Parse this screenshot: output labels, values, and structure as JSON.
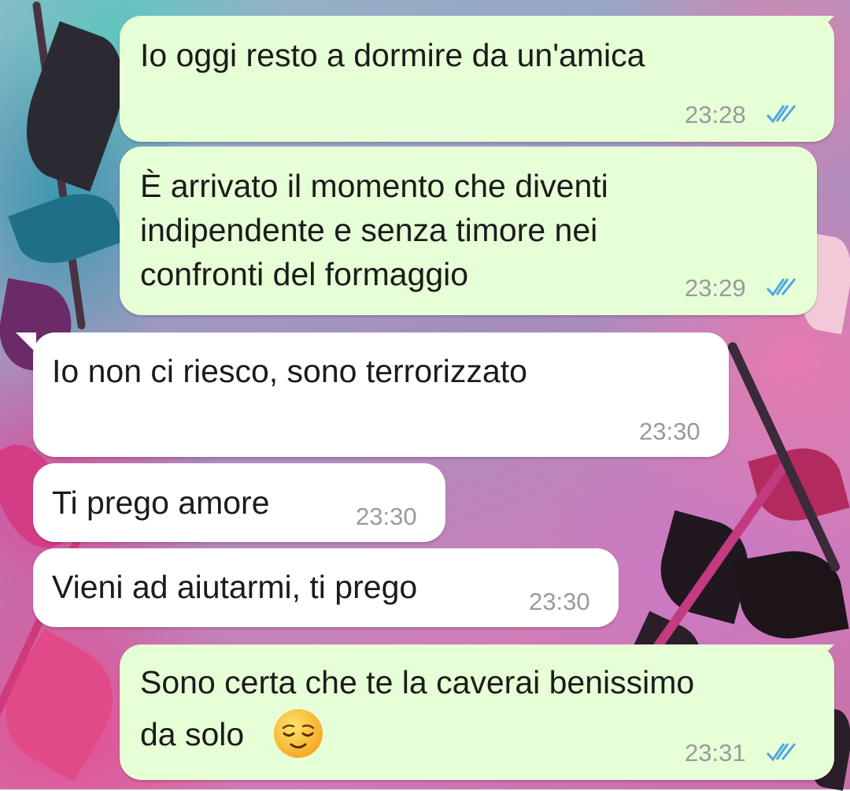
{
  "messages": [
    {
      "direction": "outgoing",
      "text": "Io oggi resto a dormire da un'amica",
      "time": "23:28",
      "status_icon": "double-check-read-icon"
    },
    {
      "direction": "outgoing",
      "lines": [
        "È arrivato il momento che diventi",
        "indipendente e senza timore nei",
        "confronti del formaggio"
      ],
      "time": "23:29",
      "status_icon": "double-check-read-icon"
    },
    {
      "direction": "incoming",
      "text": "Io non ci riesco, sono terrorizzato",
      "time": "23:30"
    },
    {
      "direction": "incoming",
      "text": "Ti prego amore",
      "time": "23:30"
    },
    {
      "direction": "incoming",
      "text": "Vieni ad aiutarmi, ti prego",
      "time": "23:30"
    },
    {
      "direction": "outgoing",
      "lines": [
        "Sono certa che te la caverai benissimo",
        "da solo"
      ],
      "emoji": "relieved-face-emoji",
      "time": "23:31",
      "status_icon": "double-check-read-icon"
    }
  ],
  "colors": {
    "outgoing_bubble": "#e6ffd6",
    "incoming_bubble": "#ffffff",
    "read_ticks": "#4fa7e3",
    "timestamp": "#9a9a9a"
  }
}
